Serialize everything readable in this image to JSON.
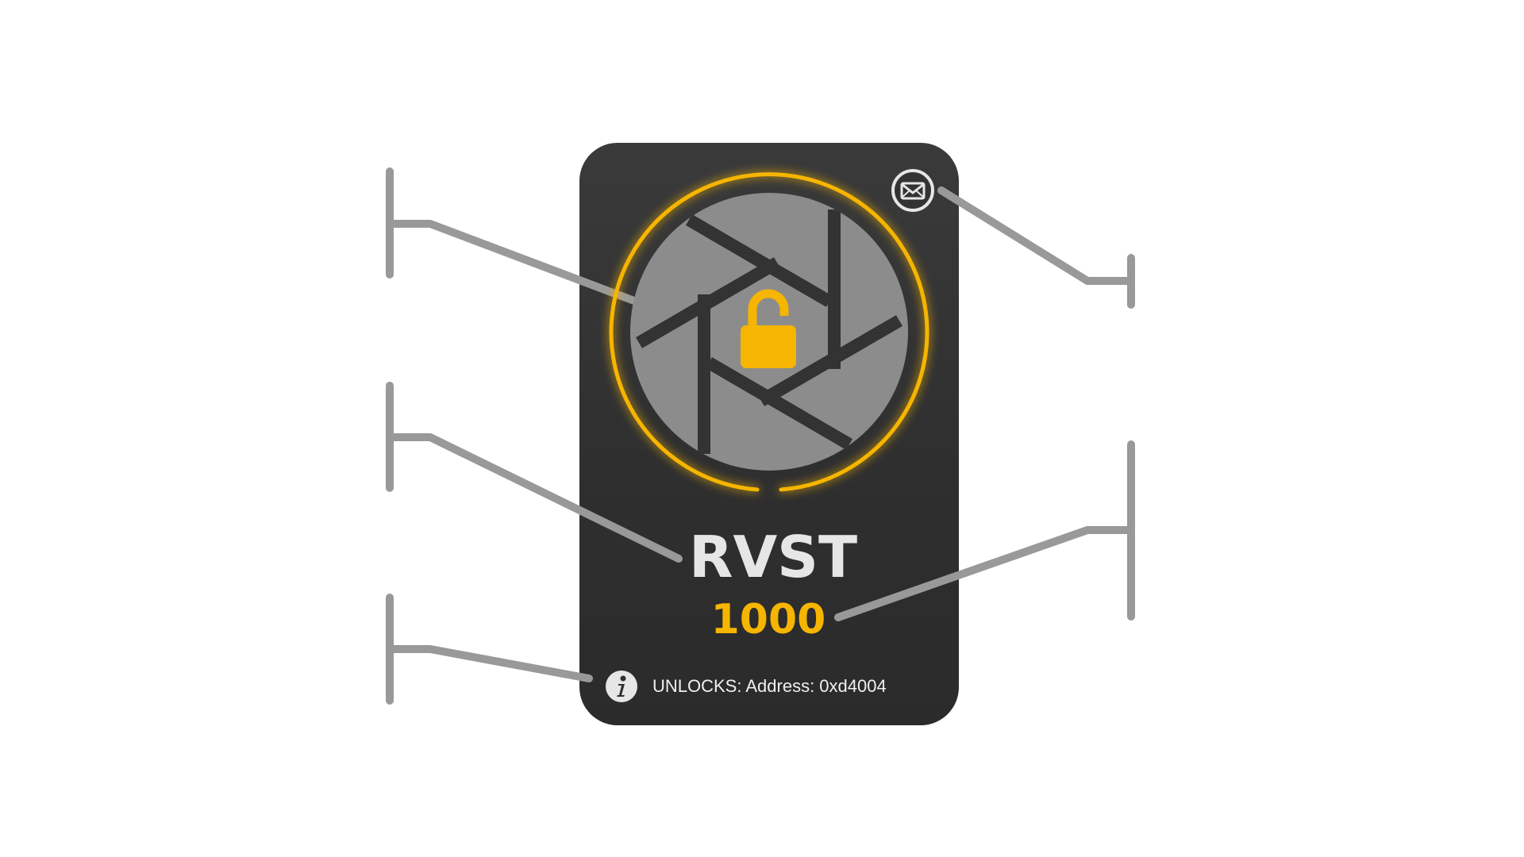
{
  "token": {
    "symbol": "RVST",
    "amount": "1000",
    "unlocks_text": "UNLOCKS: Address: 0xd4004"
  },
  "icons": {
    "status": "padlock-icon",
    "contact": "envelope-icon",
    "info": "info-icon",
    "graphic": "camera-aperture-icon"
  },
  "colors": {
    "card_background": "#333333",
    "accent": "#f6b500",
    "aperture_blades": "#8c8c8c",
    "title_text": "#e6e6e6",
    "connector_lines": "#999999",
    "page_background": "#ffffff"
  }
}
